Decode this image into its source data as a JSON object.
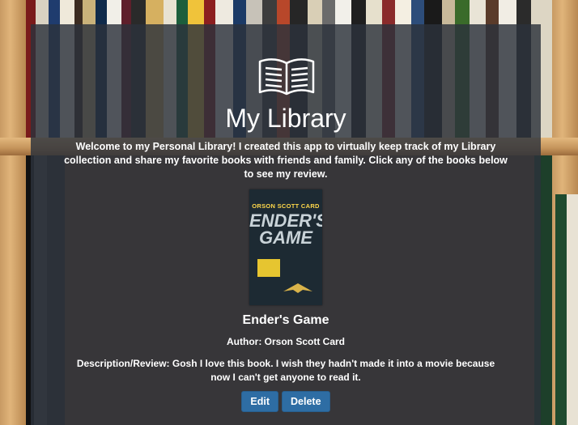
{
  "page": {
    "title": "My Library",
    "intro": "Welcome to my Personal Library! I created this app to virtually keep track of my Library collection and share my favorite books with friends and family. Click any of the books below to see my review.",
    "icons": {
      "header": "open-book-icon"
    }
  },
  "book": {
    "cover_author": "ORSON SCOTT CARD",
    "cover_title": "ENDER'S GAME",
    "name": "Ender's Game",
    "author_line": "Author: Orson Scott Card",
    "review_line": "Description/Review: Gosh I love this book. I wish they hadn't made it into a movie because now I can't get anyone to read it."
  },
  "actions": {
    "edit_label": "Edit",
    "delete_label": "Delete"
  },
  "colors": {
    "panel": "#2c323c",
    "button": "#2e6da4",
    "text": "#ffffff"
  }
}
